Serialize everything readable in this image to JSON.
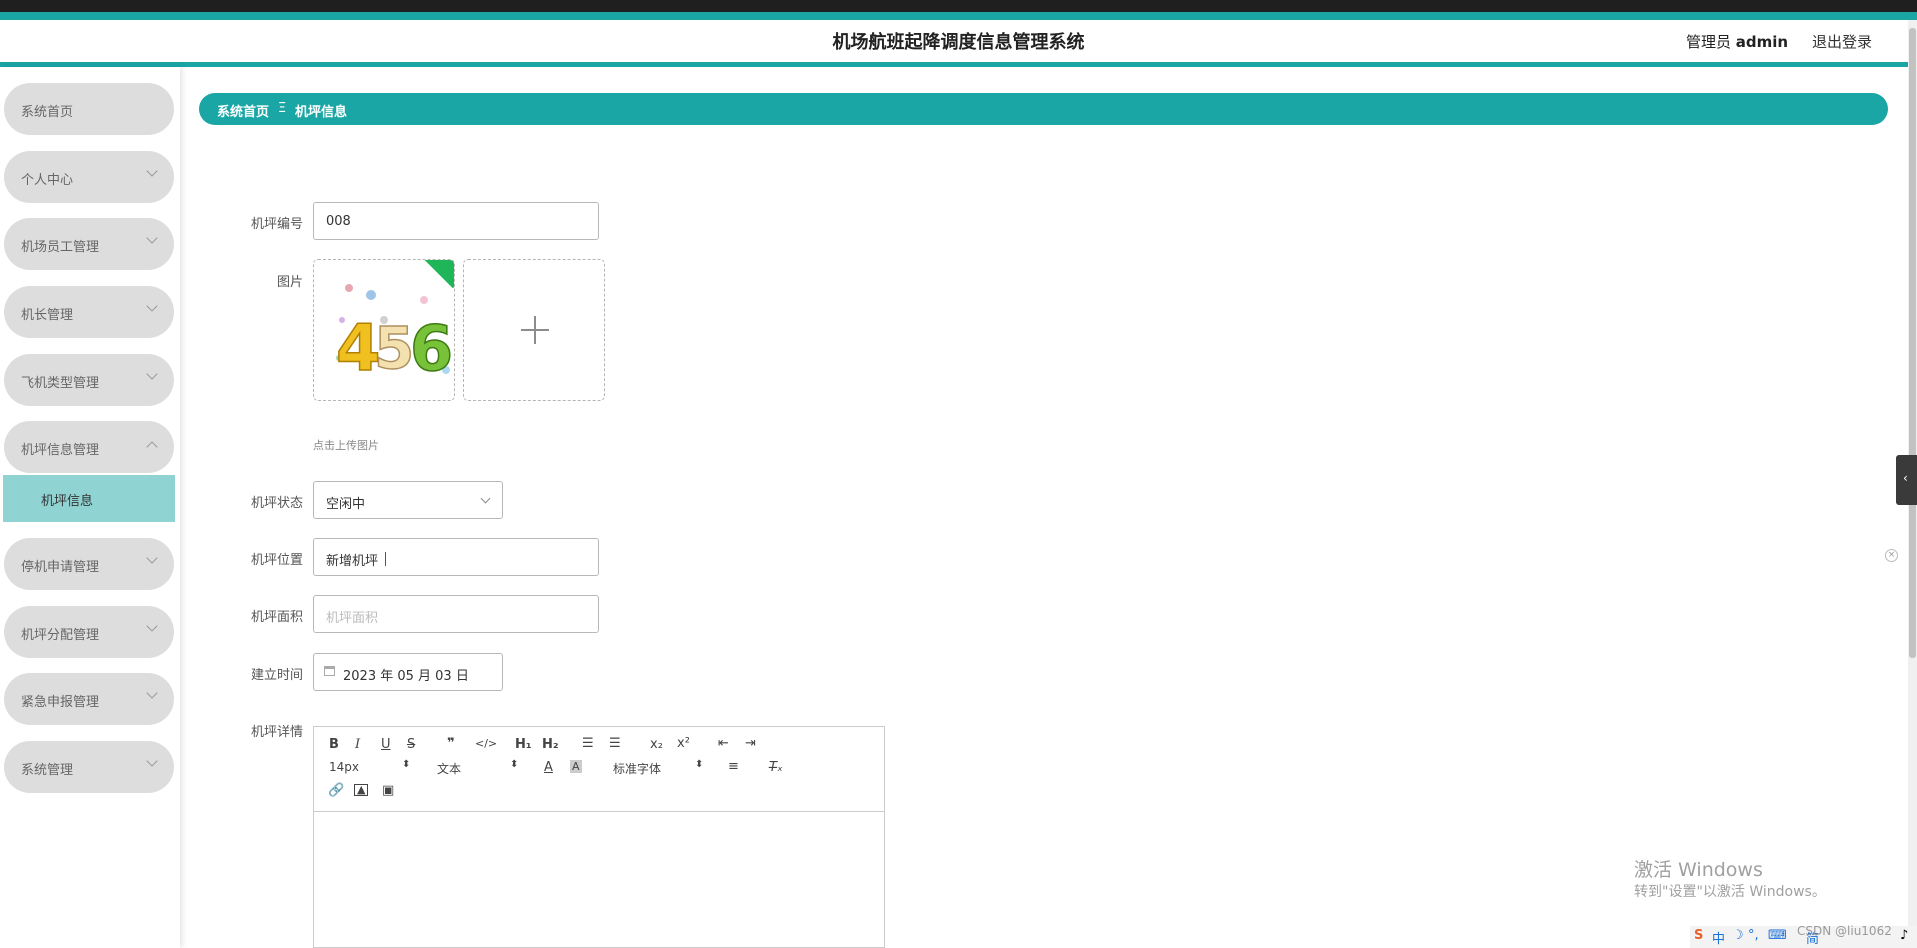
{
  "header": {
    "title": "机场航班起降调度信息管理系统",
    "admin_prefix": "管理员",
    "admin_name": "admin",
    "logout": "退出登录"
  },
  "sidebar": {
    "items": [
      {
        "label": "系统首页"
      },
      {
        "label": "个人中心"
      },
      {
        "label": "机场员工管理"
      },
      {
        "label": "机长管理"
      },
      {
        "label": "飞机类型管理"
      },
      {
        "label": "机坪信息管理"
      },
      {
        "label": "停机申请管理"
      },
      {
        "label": "机坪分配管理"
      },
      {
        "label": "紧急申报管理"
      },
      {
        "label": "系统管理"
      }
    ],
    "active_sub": "机坪信息"
  },
  "breadcrumb": {
    "home": "系统首页",
    "sep": "Ξ",
    "current": "机坪信息"
  },
  "form": {
    "apron_no_label": "机坪编号",
    "apron_no_value": "008",
    "image_label": "图片",
    "image_hint": "点击上传图片",
    "status_label": "机坪状态",
    "status_value": "空闲中",
    "location_label": "机坪位置",
    "location_value": "新增机坪",
    "area_label": "机坪面积",
    "area_placeholder": "机坪面积",
    "built_label": "建立时间",
    "built_value": "2023 年 05 月 03 日",
    "detail_label": "机坪详情"
  },
  "editor": {
    "font_size": "14px",
    "text_type": "文本",
    "font_family": "标准字体"
  },
  "system": {
    "watermark_line1": "激活 Windows",
    "watermark_line2": "转到\"设置\"以激活 Windows。",
    "csdn": "CSDN @liu1062"
  }
}
